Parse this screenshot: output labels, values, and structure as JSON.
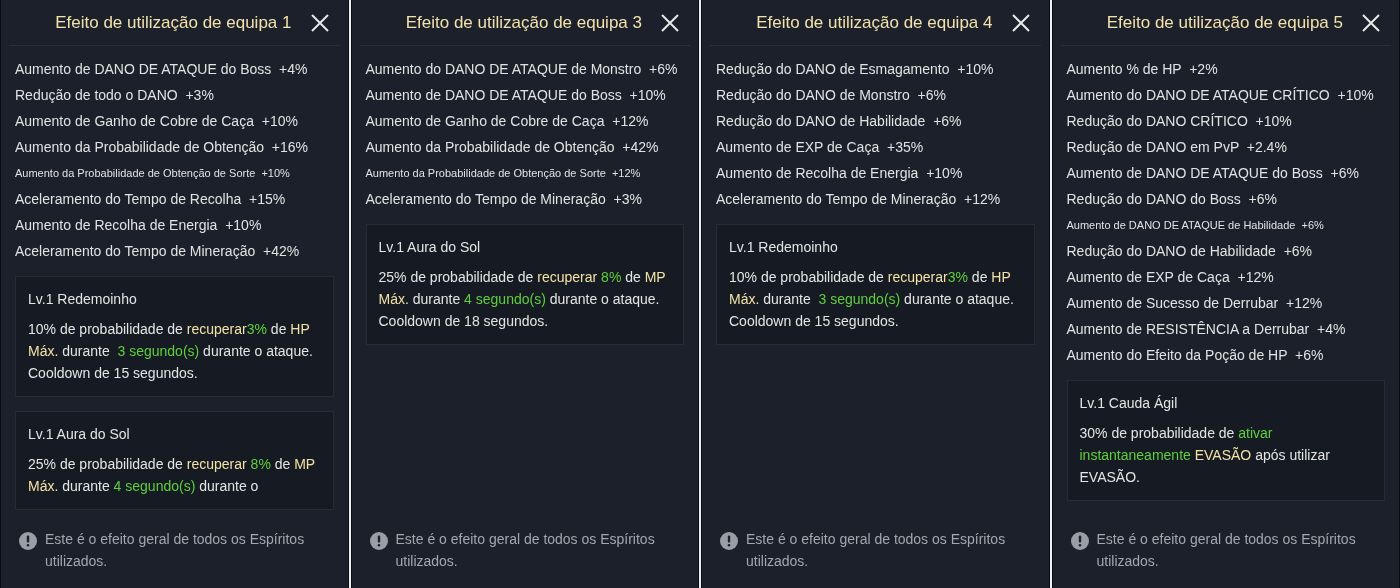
{
  "panels": [
    {
      "title": "Efeito de utilização de equipa 1",
      "stats": [
        {
          "text": "Aumento de DANO DE ATAQUE do Boss  +4%",
          "compact": false
        },
        {
          "text": "Redução de todo o DANO  +3%",
          "compact": false
        },
        {
          "text": "Aumento de Ganho de Cobre de Caça  +10%",
          "compact": false
        },
        {
          "text": "Aumento da Probabilidade de Obtenção  +16%",
          "compact": false
        },
        {
          "text": "Aumento da Probabilidade de Obtenção de Sorte  +10%",
          "compact": true
        },
        {
          "text": "Aceleramento do Tempo de Recolha  +15%",
          "compact": false
        },
        {
          "text": "Aumento de Recolha de Energia  +10%",
          "compact": false
        },
        {
          "text": "Aceleramento do Tempo de Mineração  +42%",
          "compact": false
        }
      ],
      "skills": [
        {
          "name": "Lv.1 Redemoinho",
          "segments": [
            {
              "text": "10% de probabilidade de ",
              "kind": "plain"
            },
            {
              "text": "recuperar",
              "kind": "highlight"
            },
            {
              "text": "3%",
              "kind": "value"
            },
            {
              "text": " de ",
              "kind": "plain"
            },
            {
              "text": "HP Máx.",
              "kind": "highlight"
            },
            {
              "text": " durante  ",
              "kind": "plain"
            },
            {
              "text": "3 segundo(s)",
              "kind": "value"
            },
            {
              "text": " durante o ataque. Cooldown de 15 segundos.",
              "kind": "plain"
            }
          ]
        },
        {
          "name": "Lv.1 Aura do Sol",
          "segments": [
            {
              "text": "25% de probabilidade de ",
              "kind": "plain"
            },
            {
              "text": "recuperar",
              "kind": "highlight"
            },
            {
              "text": " 8%",
              "kind": "value"
            },
            {
              "text": " de ",
              "kind": "plain"
            },
            {
              "text": "MP Máx.",
              "kind": "highlight"
            },
            {
              "text": " durante ",
              "kind": "plain"
            },
            {
              "text": "4 segundo(s)",
              "kind": "value"
            },
            {
              "text": " durante o",
              "kind": "plain"
            }
          ]
        }
      ],
      "note": "Este é o efeito geral de todos os Espíritos utilizados."
    },
    {
      "title": "Efeito de utilização de equipa 3",
      "stats": [
        {
          "text": "Aumento do DANO DE ATAQUE de Monstro  +6%",
          "compact": false
        },
        {
          "text": "Aumento de DANO DE ATAQUE do Boss  +10%",
          "compact": false
        },
        {
          "text": "Aumento de Ganho de Cobre de Caça  +12%",
          "compact": false
        },
        {
          "text": "Aumento da Probabilidade de Obtenção  +42%",
          "compact": false
        },
        {
          "text": "Aumento da Probabilidade de Obtenção de Sorte  +12%",
          "compact": true
        },
        {
          "text": "Aceleramento do Tempo de Mineração  +3%",
          "compact": false
        }
      ],
      "skills": [
        {
          "name": "Lv.1 Aura do Sol",
          "segments": [
            {
              "text": "25% de probabilidade de ",
              "kind": "plain"
            },
            {
              "text": "recuperar",
              "kind": "highlight"
            },
            {
              "text": " 8%",
              "kind": "value"
            },
            {
              "text": " de ",
              "kind": "plain"
            },
            {
              "text": "MP Máx.",
              "kind": "highlight"
            },
            {
              "text": " durante ",
              "kind": "plain"
            },
            {
              "text": "4 segundo(s)",
              "kind": "value"
            },
            {
              "text": " durante o ataque. Cooldown de 18 segundos.",
              "kind": "plain"
            }
          ]
        }
      ],
      "note": "Este é o efeito geral de todos os Espíritos utilizados."
    },
    {
      "title": "Efeito de utilização de equipa 4",
      "stats": [
        {
          "text": "Redução do DANO de Esmagamento  +10%",
          "compact": false
        },
        {
          "text": "Redução do DANO de Monstro  +6%",
          "compact": false
        },
        {
          "text": "Redução do DANO de Habilidade  +6%",
          "compact": false
        },
        {
          "text": "Aumento de EXP de Caça  +35%",
          "compact": false
        },
        {
          "text": "Aumento de Recolha de Energia  +10%",
          "compact": false
        },
        {
          "text": "Aceleramento do Tempo de Mineração  +12%",
          "compact": false
        }
      ],
      "skills": [
        {
          "name": "Lv.1 Redemoinho",
          "segments": [
            {
              "text": "10% de probabilidade de ",
              "kind": "plain"
            },
            {
              "text": "recuperar",
              "kind": "highlight"
            },
            {
              "text": "3%",
              "kind": "value"
            },
            {
              "text": " de ",
              "kind": "plain"
            },
            {
              "text": "HP Máx.",
              "kind": "highlight"
            },
            {
              "text": " durante  ",
              "kind": "plain"
            },
            {
              "text": "3 segundo(s)",
              "kind": "value"
            },
            {
              "text": " durante o ataque. Cooldown de 15 segundos.",
              "kind": "plain"
            }
          ]
        }
      ],
      "note": "Este é o efeito geral de todos os Espíritos utilizados."
    },
    {
      "title": "Efeito de utilização de equipa 5",
      "stats": [
        {
          "text": "Aumento % de HP  +2%",
          "compact": false
        },
        {
          "text": "Aumento do DANO DE ATAQUE CRÍTICO  +10%",
          "compact": false
        },
        {
          "text": "Redução do DANO CRÍTICO  +10%",
          "compact": false
        },
        {
          "text": "Redução de DANO em PvP  +2.4%",
          "compact": false
        },
        {
          "text": "Aumento de DANO DE ATAQUE do Boss  +6%",
          "compact": false
        },
        {
          "text": "Redução do DANO do Boss  +6%",
          "compact": false
        },
        {
          "text": "Aumento de DANO DE ATAQUE de Habilidade  +6%",
          "compact": true
        },
        {
          "text": "Redução do DANO de Habilidade  +6%",
          "compact": false
        },
        {
          "text": "Aumento de EXP de Caça  +12%",
          "compact": false
        },
        {
          "text": "Aumento de Sucesso de Derrubar  +12%",
          "compact": false
        },
        {
          "text": "Aumento de RESISTÊNCIA a Derrubar  +4%",
          "compact": false
        },
        {
          "text": "Aumento do Efeito da Poção de HP  +6%",
          "compact": false
        }
      ],
      "skills": [
        {
          "name": "Lv.1 Cauda Ágil",
          "segments": [
            {
              "text": "30% de probabilidade de ",
              "kind": "plain"
            },
            {
              "text": "ativar instantaneamente",
              "kind": "value"
            },
            {
              "text": " EVASÃO",
              "kind": "highlight"
            },
            {
              "text": " após utilizar EVASÃO.",
              "kind": "plain"
            }
          ]
        }
      ],
      "note": "Este é o efeito geral de todos os Espíritos utilizados."
    }
  ]
}
